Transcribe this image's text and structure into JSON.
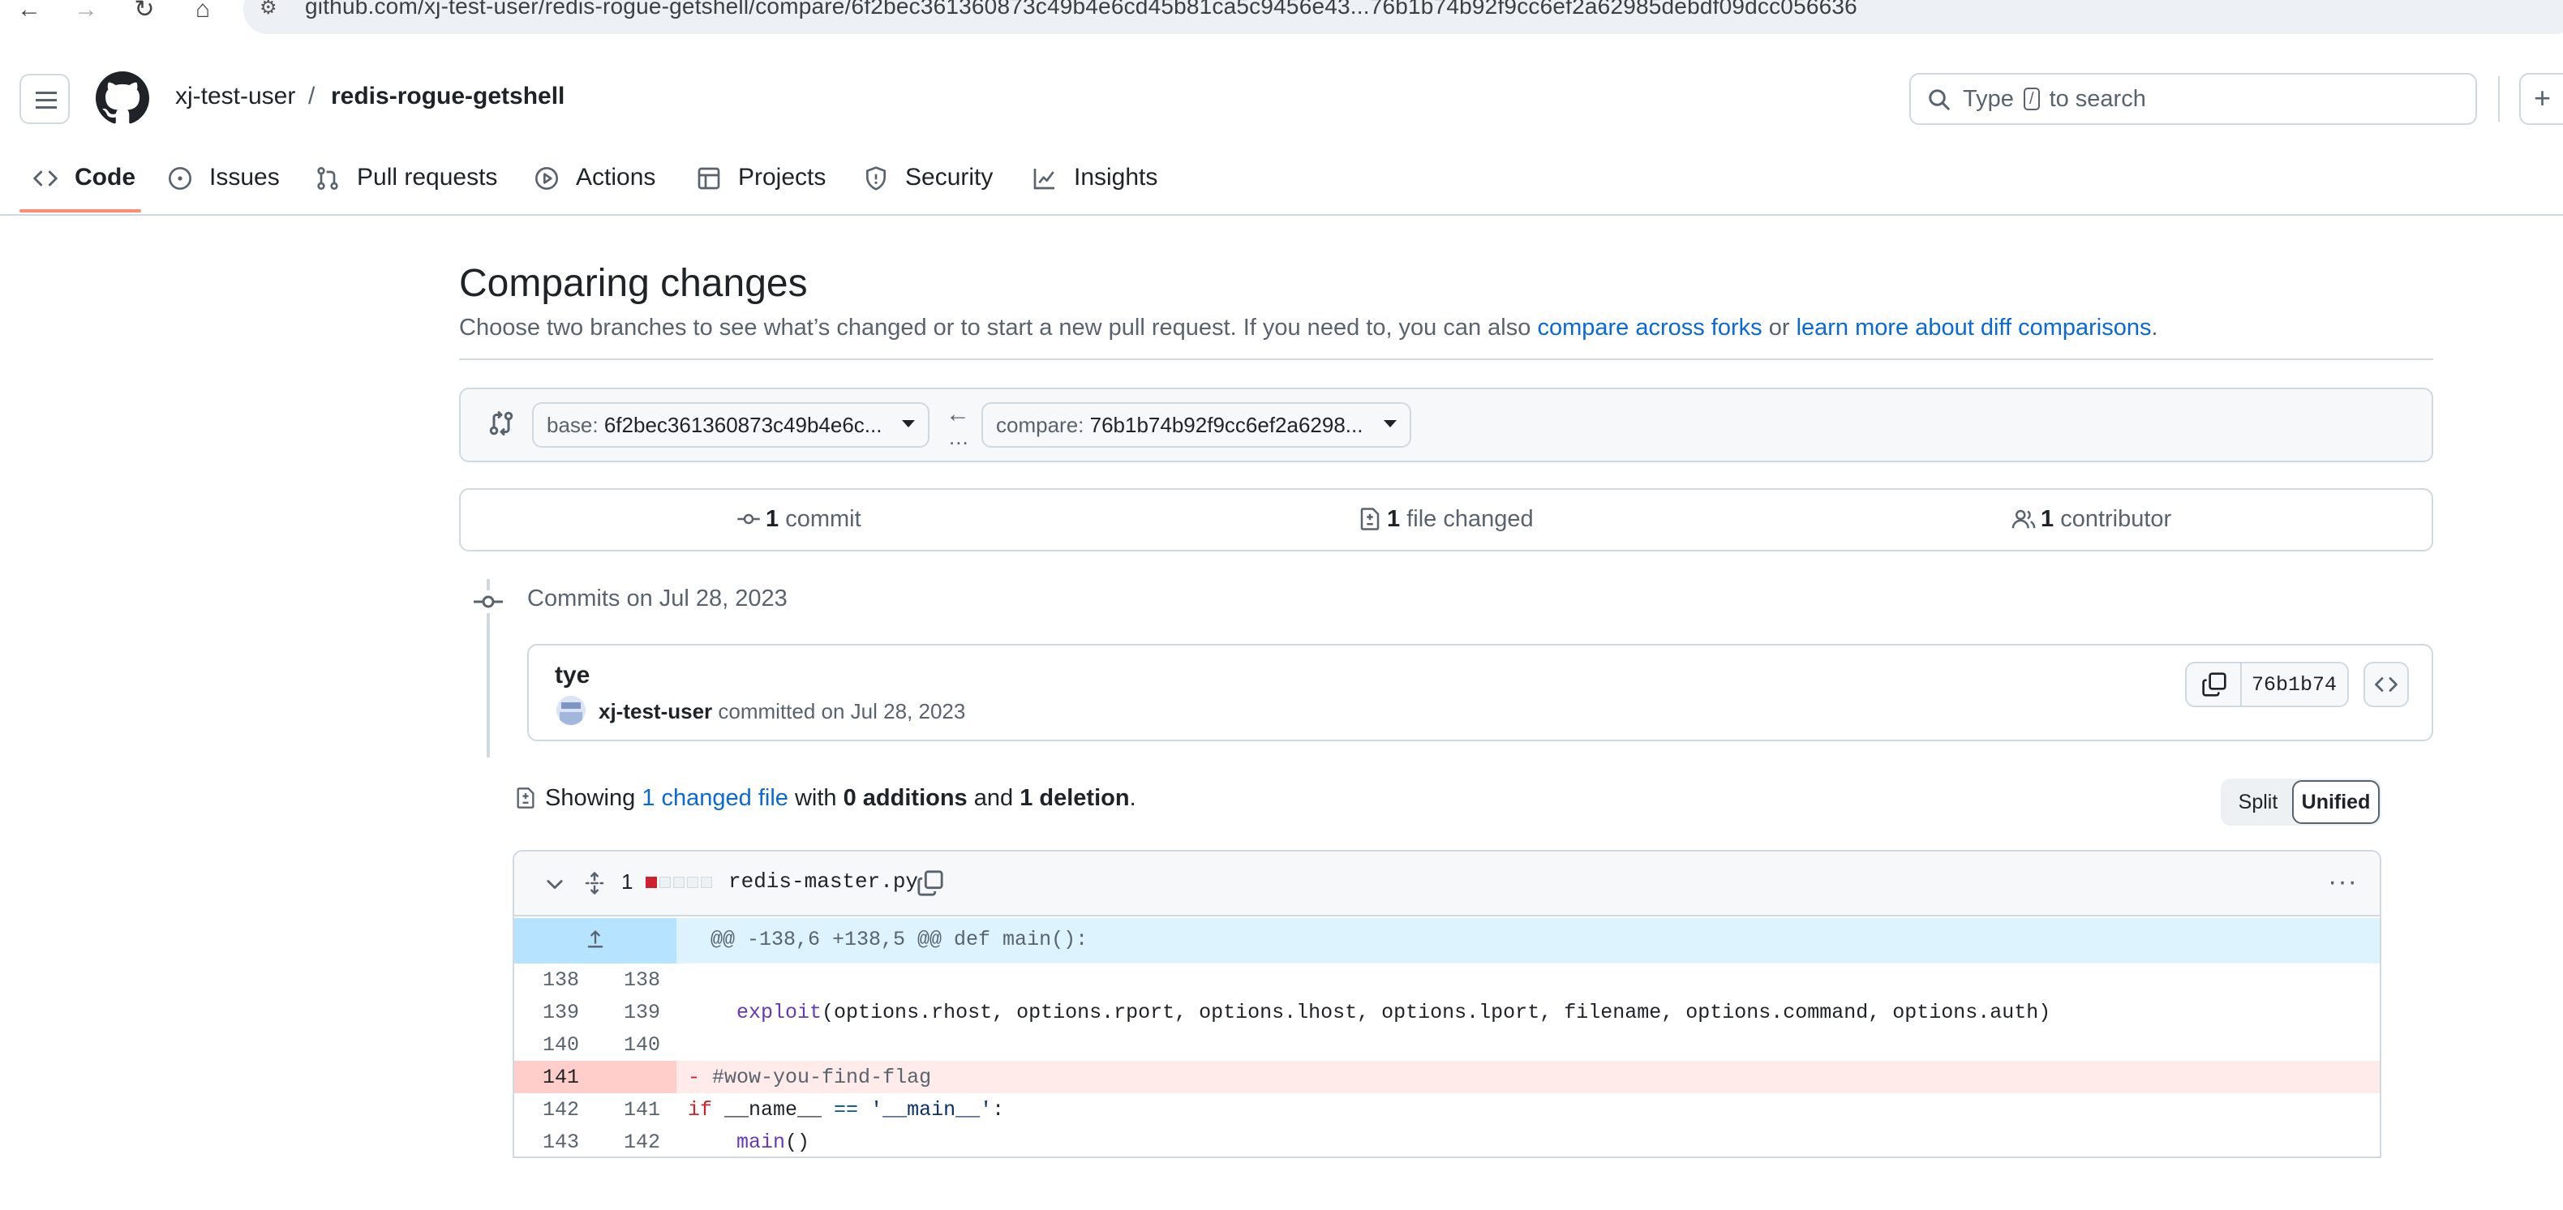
{
  "browser": {
    "url": "github.com/xj-test-user/redis-rogue-getshell/compare/6f2bec361360873c49b4e6cd45b81ca5c9456e43...76b1b74b92f9cc6ef2a62985debdf09dcc056636"
  },
  "header": {
    "owner": "xj-test-user",
    "separator": "/",
    "repo": "redis-rogue-getshell",
    "search_prefix": "Type",
    "search_key": "/",
    "search_suffix": "to search",
    "plus_label": "+"
  },
  "repo_nav": {
    "tabs": [
      {
        "label": "Code",
        "icon": "code-icon",
        "active": true
      },
      {
        "label": "Issues",
        "icon": "issue-icon"
      },
      {
        "label": "Pull requests",
        "icon": "pull-request-icon"
      },
      {
        "label": "Actions",
        "icon": "play-icon"
      },
      {
        "label": "Projects",
        "icon": "table-icon"
      },
      {
        "label": "Security",
        "icon": "shield-icon"
      },
      {
        "label": "Insights",
        "icon": "graph-icon"
      }
    ]
  },
  "compare": {
    "title": "Comparing changes",
    "desc_before": "Choose two branches to see what’s changed or to start a new pull request. If you need to, you can also ",
    "desc_link1": "compare across forks",
    "desc_middle": " or ",
    "desc_link2": "learn more about diff comparisons",
    "desc_after": ".",
    "base_key": "base:",
    "base_value": "6f2bec361360873c49b4e6c...",
    "compare_key": "compare:",
    "compare_value": "76b1b74b92f9cc6ef2a6298...",
    "swap_arrow": "←",
    "swap_dots": "...",
    "summary": {
      "commits_count": "1",
      "commits_label": "commit",
      "files_count": "1",
      "files_label": "file changed",
      "contributors_count": "1",
      "contributors_label": "contributor"
    }
  },
  "commits": {
    "date_heading": "Commits on Jul 28, 2023",
    "items": [
      {
        "title": "tye",
        "author": "xj-test-user",
        "meta": "committed on Jul 28, 2023",
        "sha": "76b1b74"
      }
    ]
  },
  "diff": {
    "showing_prefix": "Showing",
    "changed_link": "1 changed file",
    "showing_with": "with",
    "additions": "0 additions",
    "and": "and",
    "deletions": "1 deletion",
    "period": ".",
    "view_split": "Split",
    "view_unified": "Unified",
    "file": {
      "count": "1",
      "name": "redis-master.py",
      "diffstat": [
        "deleted",
        "neutral",
        "neutral",
        "neutral",
        "neutral"
      ],
      "hunk_header": "@@ -138,6 +138,5 @@ def main():",
      "lines": [
        {
          "old": "138",
          "new": "138",
          "type": "context",
          "code": ""
        },
        {
          "old": "139",
          "new": "139",
          "type": "context",
          "code": "    exploit(options.rhost, options.rport, options.lhost, options.lport, filename, options.command, options.auth)"
        },
        {
          "old": "140",
          "new": "140",
          "type": "context",
          "code": ""
        },
        {
          "old": "141",
          "new": "",
          "type": "deleted",
          "code": "- #wow-you-find-flag"
        },
        {
          "old": "142",
          "new": "141",
          "type": "context",
          "code": "if __name__ == '__main__':"
        },
        {
          "old": "143",
          "new": "142",
          "type": "context",
          "code": "    main()"
        }
      ]
    }
  },
  "colors": {
    "accent": "#0969da",
    "tab_underline": "#fd8c73",
    "deleted_bg": "#ffebe9",
    "deleted_num_bg": "#ffcecb",
    "hunk_bg": "#ddf4ff",
    "diffstat_deleted": "#cf222e"
  }
}
